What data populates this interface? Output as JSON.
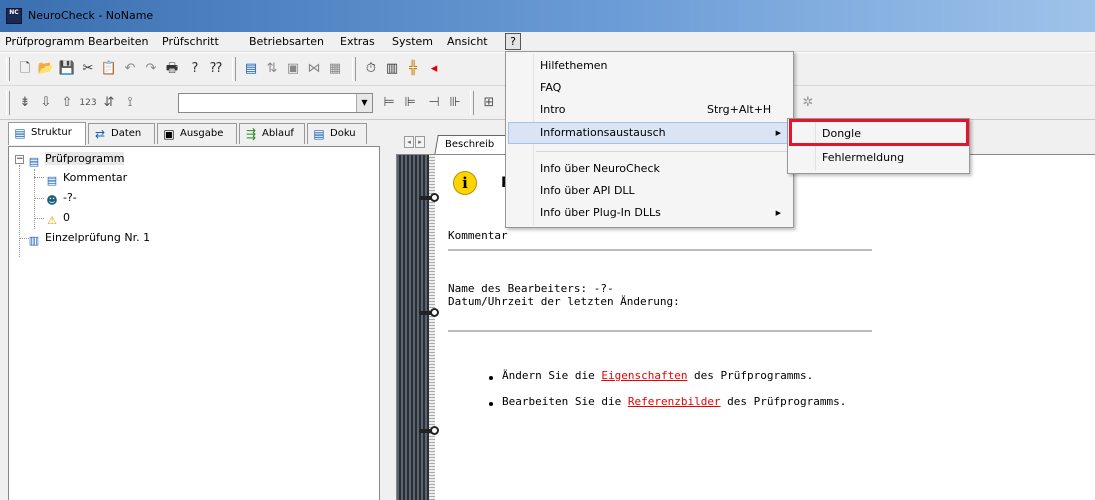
{
  "window": {
    "title": "NeuroCheck - NoName",
    "icon_text": "NC"
  },
  "menubar": {
    "items": [
      "Prüfprogramm",
      "Bearbeiten",
      "Prüfschritt",
      "Betriebsarten",
      "Extras",
      "System",
      "Ansicht",
      "?"
    ]
  },
  "left_tabs": [
    "Struktur",
    "Daten",
    "Ausgabe",
    "Ablauf",
    "Doku"
  ],
  "tree": {
    "root": "Prüfprogramm",
    "children": [
      "Kommentar",
      "-?-",
      "0"
    ],
    "sibling": "Einzelprüfung Nr. 1"
  },
  "doc": {
    "tab_label": "Beschreib",
    "heading": "P",
    "comment_label": "Kommentar",
    "editor_line": "Name des Bearbeiters: -?-",
    "date_line": "Datum/Uhrzeit der letzten Änderung:",
    "bullet1": {
      "pre": "Ändern Sie die ",
      "link": "Eigenschaften",
      "post": " des Prüfprogramms."
    },
    "bullet2": {
      "pre": "Bearbeiten Sie die ",
      "link": "Referenzbilder",
      "post": " des Prüfprogramms."
    }
  },
  "help_menu": {
    "items": [
      {
        "label": "Hilfethemen",
        "shortcut": ""
      },
      {
        "label": "FAQ",
        "shortcut": ""
      },
      {
        "label": "Intro",
        "shortcut": "Strg+Alt+H"
      },
      {
        "label": "Informationsaustausch",
        "shortcut": ""
      },
      {
        "label": "Info über NeuroCheck",
        "shortcut": ""
      },
      {
        "label": "Info über API DLL",
        "shortcut": ""
      },
      {
        "label": "Info über Plug-In DLLs",
        "shortcut": ""
      }
    ]
  },
  "submenu": {
    "items": [
      "Dongle",
      "Fehlermeldung"
    ]
  },
  "colors": {
    "highlight_box": "#e5142d",
    "link": "#e00000",
    "menu_hover": "#d9e4f5"
  }
}
